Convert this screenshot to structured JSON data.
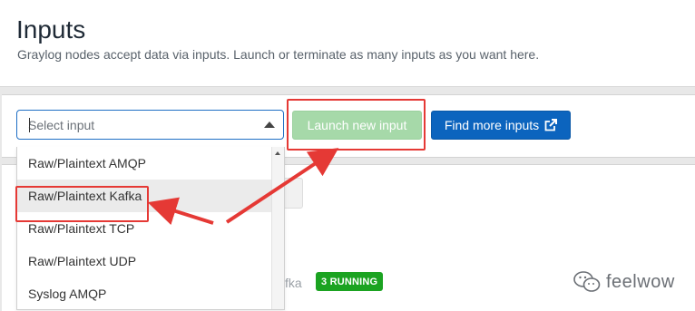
{
  "page": {
    "title": "Inputs",
    "description": "Graylog nodes accept data via inputs. Launch or terminate as many inputs as you want here."
  },
  "toolbar": {
    "select_placeholder": "Select input",
    "launch_label": "Launch new input",
    "find_label": "Find more inputs"
  },
  "dropdown": {
    "options": [
      {
        "label": "Raw/Plaintext AMQP"
      },
      {
        "label": "Raw/Plaintext Kafka"
      },
      {
        "label": "Raw/Plaintext TCP"
      },
      {
        "label": "Raw/Plaintext UDP"
      },
      {
        "label": "Syslog AMQP"
      }
    ],
    "highlighted_index": 1
  },
  "background_list": {
    "partial_text": "fka",
    "badge": "3 RUNNING"
  },
  "watermark": {
    "text": "feelwow",
    "icon": "wechat-icon"
  },
  "colors": {
    "primary": "#0c64be",
    "success_disabled": "#a6d9a9",
    "badge_green": "#1ba321",
    "annotation_red": "#e53935"
  }
}
